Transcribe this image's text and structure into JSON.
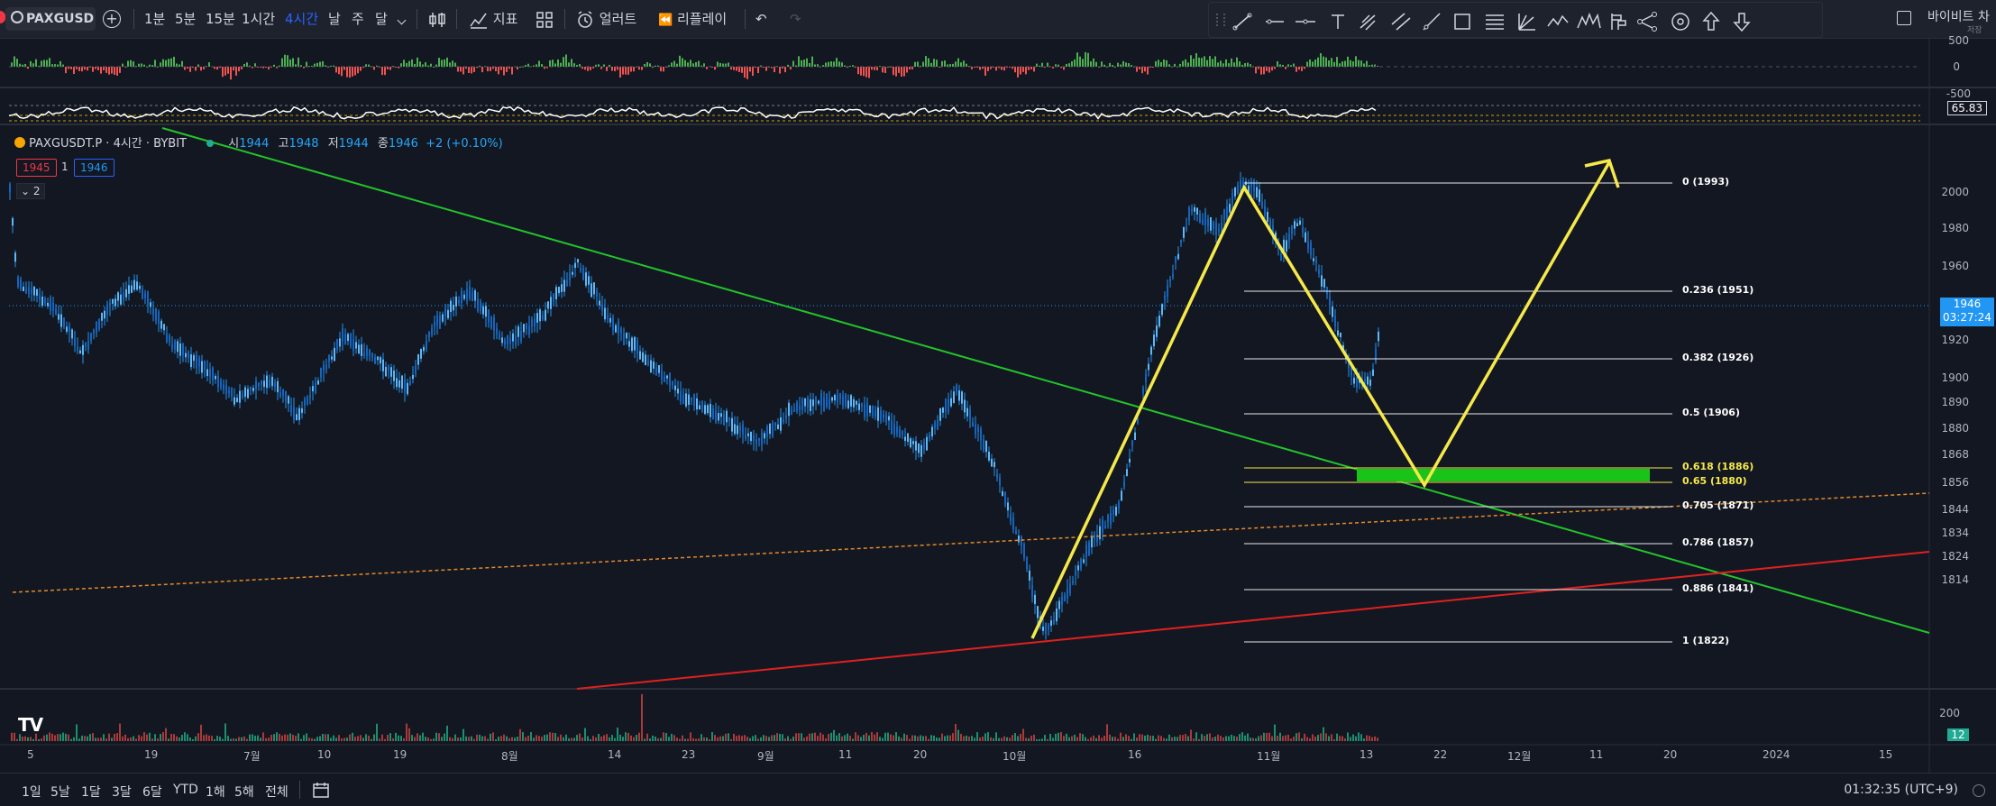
{
  "toolbar": {
    "symbol": "PAXGUSD",
    "intervals": [
      "1분",
      "5분",
      "15분",
      "1시간",
      "4시간",
      "날",
      "주",
      "달"
    ],
    "active_interval": "4시간",
    "indicators_label": "지표",
    "alerts_label": "얼러트",
    "replay_label": "리플레이",
    "right_label": "바이비트 차",
    "right_sub": "저장"
  },
  "chart_header": {
    "pair": "PAXGUSDT.P · 4시간 · BYBIT",
    "o_label": "시",
    "o_value": "1944",
    "h_label": "고",
    "h_value": "1948",
    "l_label": "저",
    "l_value": "1944",
    "c_label": "종",
    "c_value": "1946",
    "change": "+2 (+0.10%)",
    "bid": "1945",
    "spread": "1",
    "ask": "1946",
    "collapse_count": "2"
  },
  "indicator_axis": [
    "500",
    "0",
    "-500"
  ],
  "rsi_value": "65.83",
  "price_axis": [
    "2000",
    "1980",
    "1960",
    "1920",
    "1900",
    "1890",
    "1880",
    "1868",
    "1856",
    "1844",
    "1834",
    "1824",
    "1814"
  ],
  "last_price": {
    "price": "1946",
    "countdown": "03:27:24",
    "color": "#2196f3"
  },
  "volume_axis": {
    "label": "200",
    "current": "12"
  },
  "fib_levels": [
    {
      "label": "0 (1993)",
      "ratio": 0,
      "price": 1993
    },
    {
      "label": "0.236 (1951)",
      "ratio": 0.236,
      "price": 1951
    },
    {
      "label": "0.382 (1926)",
      "ratio": 0.382,
      "price": 1926
    },
    {
      "label": "0.5 (1906)",
      "ratio": 0.5,
      "price": 1906
    },
    {
      "label": "0.618 (1886)",
      "ratio": 0.618,
      "price": 1886
    },
    {
      "label": "0.65 (1880)",
      "ratio": 0.65,
      "price": 1880
    },
    {
      "label": "0.705 (1871)",
      "ratio": 0.705,
      "price": 1871
    },
    {
      "label": "0.786 (1857)",
      "ratio": 0.786,
      "price": 1857
    },
    {
      "label": "0.886 (1841)",
      "ratio": 0.886,
      "price": 1841
    },
    {
      "label": "1 (1822)",
      "ratio": 1,
      "price": 1822
    }
  ],
  "x_axis": [
    "5",
    "19",
    "7월",
    "10",
    "19",
    "8월",
    "14",
    "23",
    "9월",
    "11",
    "20",
    "10월",
    "16",
    "11월",
    "13",
    "22",
    "12월",
    "11",
    "20",
    "2024",
    "15"
  ],
  "bottom": {
    "ranges": [
      "1일",
      "5날",
      "1달",
      "3달",
      "6달",
      "YTD",
      "1해",
      "5해",
      "전체"
    ],
    "clock": "01:32:35 (UTC+9)"
  },
  "colors": {
    "background": "#131722",
    "candle": "#2196f3",
    "green_trend": "#22c42a",
    "red_trend": "#e0201f",
    "orange_dashed": "#e08a2a",
    "yellow_path": "#f5e94a",
    "green_zone": "#19c419"
  },
  "logo": "TV"
}
